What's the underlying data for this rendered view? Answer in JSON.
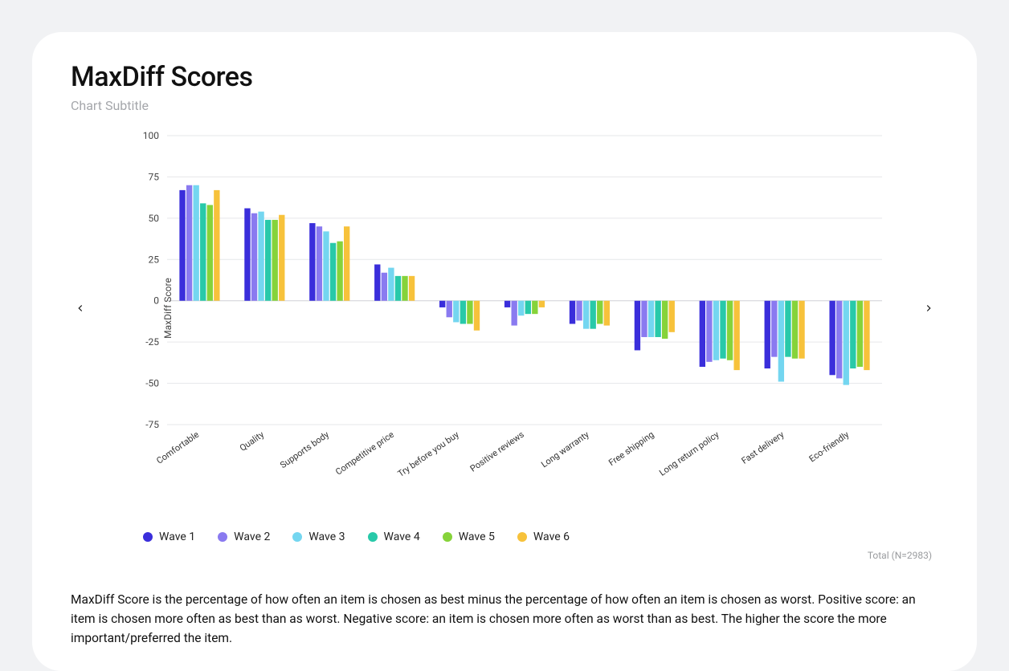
{
  "title": "MaxDiff Scores",
  "subtitle": "Chart Subtitle",
  "chart_data": {
    "type": "bar",
    "ylabel": "MaxDiff Score",
    "ylim": [
      -75,
      100
    ],
    "yticks": [
      -75,
      -50,
      -25,
      0,
      25,
      50,
      75,
      100
    ],
    "categories": [
      "Comfortable",
      "Quality",
      "Supports body",
      "Competitive price",
      "Try before you buy",
      "Positive reviews",
      "Long warranty",
      "Free shipping",
      "Long return policy",
      "Fast delivery",
      "Eco-friendly"
    ],
    "series": [
      {
        "name": "Wave 1",
        "color": "#3a2edb",
        "values": [
          67,
          56,
          47,
          22,
          -4,
          -4,
          -14,
          -30,
          -40,
          -41,
          -45
        ]
      },
      {
        "name": "Wave 2",
        "color": "#8a7af0",
        "values": [
          70,
          53,
          45,
          17,
          -10,
          -15,
          -12,
          -22,
          -37,
          -34,
          -47
        ]
      },
      {
        "name": "Wave 3",
        "color": "#74d6f0",
        "values": [
          70,
          54,
          42,
          20,
          -13,
          -9,
          -17,
          -22,
          -36,
          -49,
          -51
        ]
      },
      {
        "name": "Wave 4",
        "color": "#28c9a9",
        "values": [
          59,
          49,
          35,
          15,
          -14,
          -8,
          -17,
          -22,
          -35,
          -34,
          -41
        ]
      },
      {
        "name": "Wave 5",
        "color": "#86d33a",
        "values": [
          58,
          49,
          36,
          15,
          -14,
          -8,
          -14,
          -23,
          -36,
          -35,
          -40
        ]
      },
      {
        "name": "Wave 6",
        "color": "#f7c23b",
        "values": [
          67,
          52,
          45,
          15,
          -18,
          -4,
          -15,
          -19,
          -42,
          -35,
          -42
        ]
      }
    ]
  },
  "footnote": "Total (N=2983)",
  "description": "MaxDiff Score is the percentage of how often an item is chosen as best minus the percentage of how often an item is chosen as worst. Positive score: an item is chosen more often as best than as worst. Negative score: an item is chosen more often as worst than as best. The higher the score the more important/preferred the item."
}
